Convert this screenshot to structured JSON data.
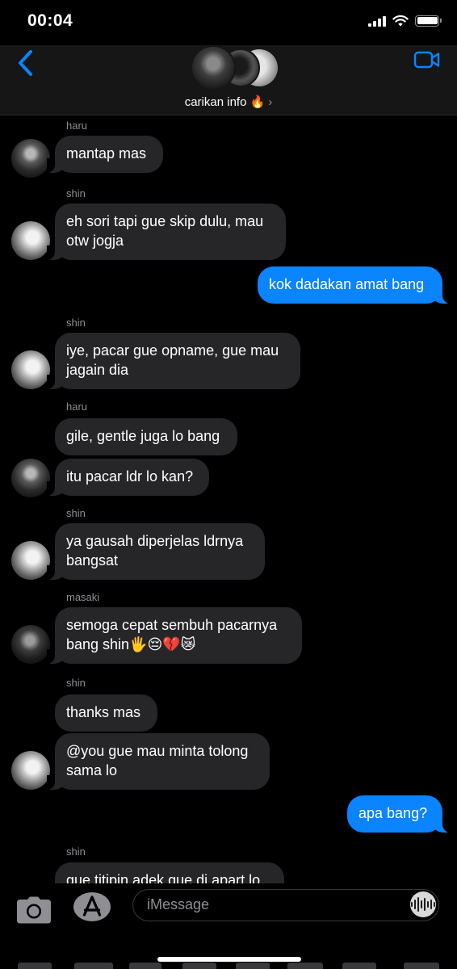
{
  "status_bar": {
    "time": "00:04"
  },
  "header": {
    "group_name": "carikan info 🔥"
  },
  "messages": [
    {
      "sender": "haru",
      "text": "mantap mas"
    },
    {
      "sender": "shin",
      "text": "eh sori tapi gue skip dulu, mau otw jogja"
    },
    {
      "sender": "you",
      "text": "kok dadakan amat bang"
    },
    {
      "sender": "shin",
      "text": "iye, pacar gue opname, gue mau jagain dia"
    },
    {
      "sender": "haru",
      "text": "gile, gentle juga lo bang"
    },
    {
      "sender": "haru",
      "text": "itu pacar ldr lo kan?"
    },
    {
      "sender": "shin",
      "text": "ya gausah diperjelas ldrnya bangsat"
    },
    {
      "sender": "masaki",
      "text": "semoga cepat sembuh pacarnya bang shin🖐️😔💔😿"
    },
    {
      "sender": "shin",
      "text": "thanks mas"
    },
    {
      "sender": "shin",
      "text": "@you gue mau minta tolong sama lo"
    },
    {
      "sender": "you",
      "text": "apa bang?"
    },
    {
      "sender": "shin",
      "text": "gue titipin adek gue di apart lo"
    }
  ],
  "input": {
    "placeholder": "iMessage"
  },
  "colors": {
    "background": "#000000",
    "incoming_bubble": "#262628",
    "outgoing_bubble": "#0a84ff",
    "accent": "#0a84ff"
  },
  "icons": [
    "back-chevron-icon",
    "video-call-icon",
    "camera-icon",
    "app-store-icon",
    "voice-memo-icon",
    "wifi-icon",
    "cellular-signal-icon",
    "battery-icon"
  ]
}
